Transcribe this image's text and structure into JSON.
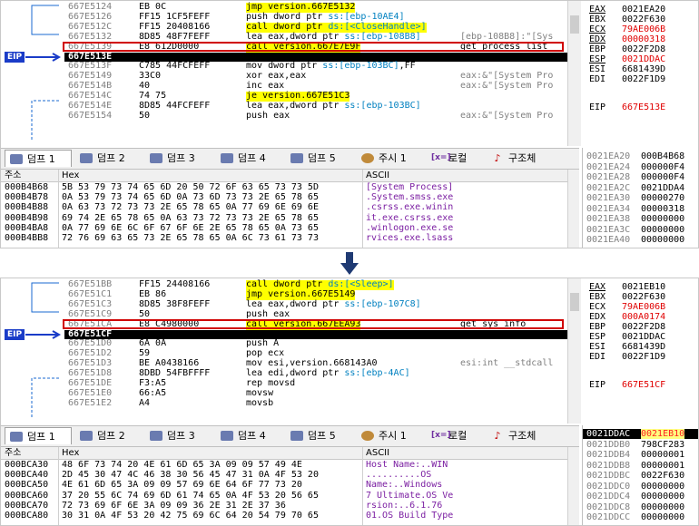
{
  "panes": [
    {
      "eip_label": "EIP",
      "eip_index": 5,
      "boxed_index": 4,
      "disasm": [
        {
          "addr": "667E5124",
          "bytes": "EB 0C",
          "asm": "jmp version.667E5132",
          "cmt": "",
          "hl": true
        },
        {
          "addr": "667E5126",
          "bytes": "FF15 1CF5FEFF",
          "asm": "push dword ptr ss:[ebp-10AE4]",
          "cmt": "",
          "hl": false
        },
        {
          "addr": "667E512C",
          "bytes": "FF15 20408166",
          "asm": "call dword ptr ds:[<CloseHandle>]",
          "cmt": "",
          "hl": true
        },
        {
          "addr": "667E5132",
          "bytes": "8D85 48F7FEFF",
          "asm": "lea eax,dword ptr ss:[ebp-108B8]",
          "cmt": "[ebp-108B8]:\"[Sys",
          "hl": false
        },
        {
          "addr": "667E5139",
          "bytes": "E8 612D0000",
          "asm": "call version.667E7E9F",
          "cmt": "get_process_list",
          "hl": true
        },
        {
          "addr": "667E513E",
          "bytes": "59",
          "asm": "pop ecx",
          "cmt": "",
          "hl": false
        },
        {
          "addr": "667E513F",
          "bytes": "C785 44FCFEFF",
          "asm": "mov dword ptr ss:[ebp-103BC],FF",
          "cmt": "",
          "hl": false
        },
        {
          "addr": "667E5149",
          "bytes": "33C0",
          "asm": "xor eax,eax",
          "cmt": "eax:&\"[System Pro",
          "hl": false
        },
        {
          "addr": "667E514B",
          "bytes": "40",
          "asm": "inc eax",
          "cmt": "eax:&\"[System Pro",
          "hl": false
        },
        {
          "addr": "667E514C",
          "bytes": "74 75",
          "asm": "je version.667E51C3",
          "cmt": "",
          "hl": true
        },
        {
          "addr": "667E514E",
          "bytes": "8D85 44FCFEFF",
          "asm": "lea eax,dword ptr ss:[ebp-103BC]",
          "cmt": "",
          "hl": false
        },
        {
          "addr": "667E5154",
          "bytes": "50",
          "asm": "push eax",
          "cmt": "eax:&\"[System Pro",
          "hl": false
        }
      ],
      "registers": [
        {
          "name": "EAX",
          "value": "0021EA20",
          "red": false,
          "ul": true
        },
        {
          "name": "EBX",
          "value": "0022F630",
          "red": false,
          "ul": false
        },
        {
          "name": "ECX",
          "value": "79AE006B",
          "red": true,
          "ul": true
        },
        {
          "name": "EDX",
          "value": "00000318",
          "red": true,
          "ul": true
        },
        {
          "name": "EBP",
          "value": "0022F2D8",
          "red": false,
          "ul": false
        },
        {
          "name": "ESP",
          "value": "0021DDAC",
          "red": true,
          "ul": true
        },
        {
          "name": "ESI",
          "value": "6681439D",
          "red": false,
          "ul": false
        },
        {
          "name": "EDI",
          "value": "0022F1D9",
          "red": false,
          "ul": false
        },
        {
          "name": "EIP",
          "value": "667E513E",
          "red": true,
          "ul": false
        }
      ],
      "tabs": [
        {
          "label": "덤프 1",
          "icon": "dump-icon",
          "active": true
        },
        {
          "label": "덤프 2",
          "icon": "dump-icon",
          "active": false
        },
        {
          "label": "덤프 3",
          "icon": "dump-icon",
          "active": false
        },
        {
          "label": "덤프 4",
          "icon": "dump-icon",
          "active": false
        },
        {
          "label": "덤프 5",
          "icon": "dump-icon",
          "active": false
        },
        {
          "label": "주시 1",
          "icon": "watch-icon",
          "active": false
        },
        {
          "label": "로컬",
          "icon": "locals-icon",
          "active": false
        },
        {
          "label": "구조체",
          "icon": "struct-icon",
          "active": false
        }
      ],
      "dump_header": {
        "addr": "주소",
        "hex": "Hex",
        "ascii": "ASCII"
      },
      "dump": [
        {
          "addr": "000B4B68",
          "hex": "5B 53 79 73 74 65 6D 20 50 72 6F 63 65 73 73 5D",
          "ascii": "[System Process]"
        },
        {
          "addr": "000B4B78",
          "hex": "0A 53 79 73 74 65 6D 0A 73 6D 73 73 2E 65 78 65",
          "ascii": ".System.smss.exe"
        },
        {
          "addr": "000B4B88",
          "hex": "0A 63 73 72 73 73 2E 65 78 65 0A 77 69 6E 69 6E",
          "ascii": ".csrss.exe.winin"
        },
        {
          "addr": "000B4B98",
          "hex": "69 74 2E 65 78 65 0A 63 73 72 73 73 2E 65 78 65",
          "ascii": "it.exe.csrss.exe"
        },
        {
          "addr": "000B4BA8",
          "hex": "0A 77 69 6E 6C 6F 67 6F 6E 2E 65 78 65 0A 73 65",
          "ascii": ".winlogon.exe.se"
        },
        {
          "addr": "000B4BB8",
          "hex": "72 76 69 63 65 73 2E 65 78 65 0A 6C 73 61 73 73",
          "ascii": "rvices.exe.lsass"
        }
      ],
      "stack": [
        {
          "addr": "0021EA20",
          "value": "000B4B68",
          "sel": false
        },
        {
          "addr": "0021EA24",
          "value": "000000F4",
          "sel": false
        },
        {
          "addr": "0021EA28",
          "value": "000000F4",
          "sel": false
        },
        {
          "addr": "0021EA2C",
          "value": "0021DDA4",
          "sel": false
        },
        {
          "addr": "0021EA30",
          "value": "00000270",
          "sel": false
        },
        {
          "addr": "0021EA34",
          "value": "00000318",
          "sel": false
        },
        {
          "addr": "0021EA38",
          "value": "00000000",
          "sel": false
        },
        {
          "addr": "0021EA3C",
          "value": "00000000",
          "sel": false
        },
        {
          "addr": "0021EA40",
          "value": "00000000",
          "sel": false
        }
      ]
    },
    {
      "eip_label": "EIP",
      "eip_index": 5,
      "boxed_index": 4,
      "disasm": [
        {
          "addr": "667E51BB",
          "bytes": "FF15 24408166",
          "asm": "call dword ptr ds:[<Sleep>]",
          "cmt": "",
          "hl": true
        },
        {
          "addr": "667E51C1",
          "bytes": "EB 86",
          "asm": "jmp version.667E5149",
          "cmt": "",
          "hl": true
        },
        {
          "addr": "667E51C3",
          "bytes": "8D85 38F8FEFF",
          "asm": "lea eax,dword ptr ss:[ebp-107C8]",
          "cmt": "",
          "hl": false
        },
        {
          "addr": "667E51C9",
          "bytes": "50",
          "asm": "push eax",
          "cmt": "",
          "hl": false
        },
        {
          "addr": "667E51CA",
          "bytes": "E8 C4980000",
          "asm": "call version.667EEA93",
          "cmt": "get_sys_info",
          "hl": true
        },
        {
          "addr": "667E51CF",
          "bytes": "59",
          "asm": "pop ecx",
          "cmt": "",
          "hl": false
        },
        {
          "addr": "667E51D0",
          "bytes": "6A 0A",
          "asm": "push A",
          "cmt": "",
          "hl": false
        },
        {
          "addr": "667E51D2",
          "bytes": "59",
          "asm": "pop ecx",
          "cmt": "",
          "hl": false
        },
        {
          "addr": "667E51D3",
          "bytes": "BE A0438166",
          "asm": "mov esi,version.668143A0",
          "cmt": "esi:int __stdcall",
          "hl": false
        },
        {
          "addr": "667E51D8",
          "bytes": "8DBD 54FBFFFF",
          "asm": "lea edi,dword ptr ss:[ebp-4AC]",
          "cmt": "",
          "hl": false
        },
        {
          "addr": "667E51DE",
          "bytes": "F3:A5",
          "asm": "rep movsd",
          "cmt": "",
          "hl": false
        },
        {
          "addr": "667E51E0",
          "bytes": "66:A5",
          "asm": "movsw",
          "cmt": "",
          "hl": false
        },
        {
          "addr": "667E51E2",
          "bytes": "A4",
          "asm": "movsb",
          "cmt": "",
          "hl": false
        }
      ],
      "registers": [
        {
          "name": "EAX",
          "value": "0021EB10",
          "red": false,
          "ul": true
        },
        {
          "name": "EBX",
          "value": "0022F630",
          "red": false,
          "ul": false
        },
        {
          "name": "ECX",
          "value": "79AE006B",
          "red": true,
          "ul": false
        },
        {
          "name": "EDX",
          "value": "000A0174",
          "red": true,
          "ul": false
        },
        {
          "name": "EBP",
          "value": "0022F2D8",
          "red": false,
          "ul": false
        },
        {
          "name": "ESP",
          "value": "0021DDAC",
          "red": false,
          "ul": false
        },
        {
          "name": "ESI",
          "value": "6681439D",
          "red": false,
          "ul": false
        },
        {
          "name": "EDI",
          "value": "0022F1D9",
          "red": false,
          "ul": false
        },
        {
          "name": "EIP",
          "value": "667E51CF",
          "red": true,
          "ul": false
        }
      ],
      "tabs": [
        {
          "label": "덤프 1",
          "icon": "dump-icon",
          "active": true
        },
        {
          "label": "덤프 2",
          "icon": "dump-icon",
          "active": false
        },
        {
          "label": "덤프 3",
          "icon": "dump-icon",
          "active": false
        },
        {
          "label": "덤프 4",
          "icon": "dump-icon",
          "active": false
        },
        {
          "label": "덤프 5",
          "icon": "dump-icon",
          "active": false
        },
        {
          "label": "주시 1",
          "icon": "watch-icon",
          "active": false
        },
        {
          "label": "로컬",
          "icon": "locals-icon",
          "active": false
        },
        {
          "label": "구조체",
          "icon": "struct-icon",
          "active": false
        }
      ],
      "dump_header": {
        "addr": "주소",
        "hex": "Hex",
        "ascii": "ASCII"
      },
      "dump": [
        {
          "addr": "000BCA30",
          "hex": "48 6F 73 74 20 4E 61 6D 65 3A 09 09 57 49 4E",
          "ascii": "Host Name:..WIN"
        },
        {
          "addr": "000BCA40",
          "hex": "2D 45 30 47 4C 46 38 30 56 45 47 31 0A 4F 53 20",
          "ascii": "..........OS "
        },
        {
          "addr": "000BCA50",
          "hex": "4E 61 6D 65 3A 09 09 57 69 6E 64 6F 77 73 20",
          "ascii": "Name:..Windows "
        },
        {
          "addr": "000BCA60",
          "hex": "37 20 55 6C 74 69 6D 61 74 65 0A 4F 53 20 56 65",
          "ascii": "7 Ultimate.OS Ve"
        },
        {
          "addr": "000BCA70",
          "hex": "72 73 69 6F 6E 3A 09 09 36 2E 31 2E 37 36",
          "ascii": "rsion:..6.1.76"
        },
        {
          "addr": "000BCA80",
          "hex": "30 31 0A 4F 53 20 42 75 69 6C 64 20 54 79 70 65",
          "ascii": "01.OS Build Type"
        }
      ],
      "stack": [
        {
          "addr": "0021DDAC",
          "value": "0021EB10",
          "sel": true
        },
        {
          "addr": "0021DDB0",
          "value": "798CF283",
          "sel": false
        },
        {
          "addr": "0021DDB4",
          "value": "00000001",
          "sel": false
        },
        {
          "addr": "0021DDB8",
          "value": "00000001",
          "sel": false
        },
        {
          "addr": "0021DDBC",
          "value": "0022F630",
          "sel": false
        },
        {
          "addr": "0021DDC0",
          "value": "00000000",
          "sel": false
        },
        {
          "addr": "0021DDC4",
          "value": "00000000",
          "sel": false
        },
        {
          "addr": "0021DDC8",
          "value": "00000000",
          "sel": false
        },
        {
          "addr": "0021DDCC",
          "value": "00000000",
          "sel": false
        }
      ]
    }
  ]
}
